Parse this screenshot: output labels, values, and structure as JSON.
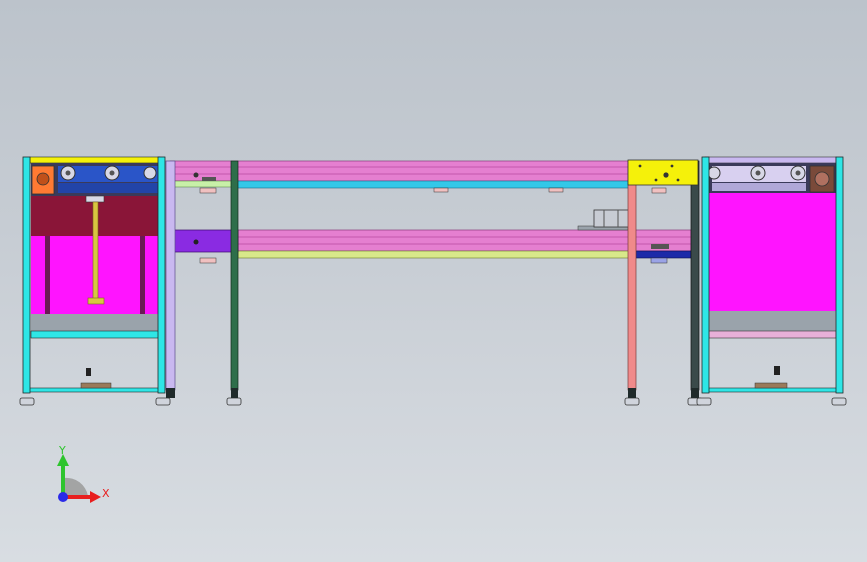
{
  "viewport": {
    "background_top": "#bcc3cb",
    "background_bottom": "#d8dde2"
  },
  "colors": {
    "frame_cyan": "#2ee6e6",
    "frame_dark": "#1f2a2a",
    "magenta": "#ff14ff",
    "maroon": "#8a1538",
    "pink_rail": "#e57fd0",
    "pink_rail_dark": "#c95cb2",
    "blue_belt": "#2a55c8",
    "cyan_rail": "#33c8e8",
    "lavender": "#c9b8f0",
    "yellow": "#f5f10a",
    "purple_block": "#8a2be2",
    "green_post": "#2e6e4a",
    "salmon_post": "#f08a8a",
    "yellow_rod": "#d8c640",
    "light_green": "#c8f0a8",
    "navy": "#1c2aa8",
    "orange_motor": "#ff7a33",
    "brown_motor": "#7a4a3a"
  },
  "triad": {
    "axes": [
      {
        "name": "Y",
        "color": "#2ec42e"
      },
      {
        "name": "X",
        "color": "#e81e1e"
      }
    ]
  }
}
